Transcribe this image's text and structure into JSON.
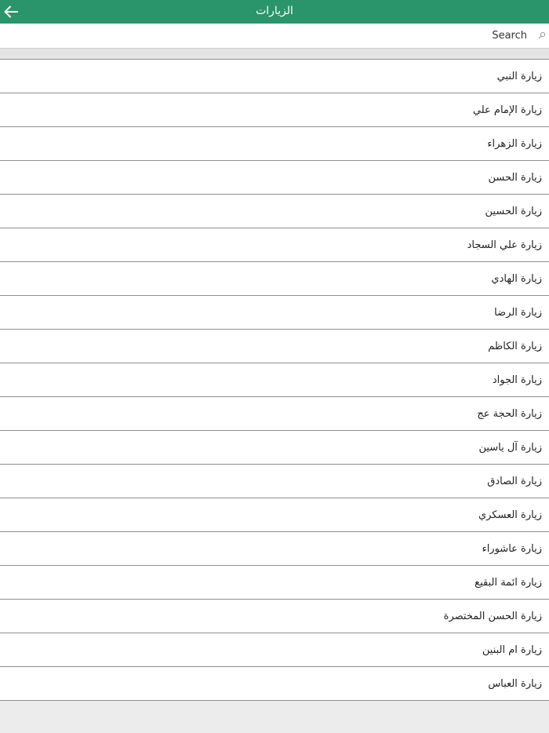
{
  "header": {
    "title": "الزيارات",
    "back_icon": "arrow-left-icon",
    "background_color": "#2a956a"
  },
  "search": {
    "placeholder": "Search",
    "value": "",
    "icon": "search-icon"
  },
  "list": {
    "items": [
      {
        "label": "زيارة النبي"
      },
      {
        "label": "زيارة الإمام علي"
      },
      {
        "label": "زيارة الزهراء"
      },
      {
        "label": "زيارة الحسن"
      },
      {
        "label": "زيارة الحسين"
      },
      {
        "label": "زيارة علي السجاد"
      },
      {
        "label": "زيارة الهادي"
      },
      {
        "label": "زيارة الرضا"
      },
      {
        "label": "زيارة الكاظم"
      },
      {
        "label": "زيارة الجواد"
      },
      {
        "label": "زيارة الحجة عج"
      },
      {
        "label": "زيارة آل ياسين"
      },
      {
        "label": "زيارة الصادق"
      },
      {
        "label": "زيارة العسكري"
      },
      {
        "label": "زيارة عاشوراء"
      },
      {
        "label": "زيارة ائمة البقيع"
      },
      {
        "label": "زيارة الحسن المختصرة"
      },
      {
        "label": "زيارة ام البنين"
      },
      {
        "label": "زيارة العباس"
      }
    ]
  }
}
